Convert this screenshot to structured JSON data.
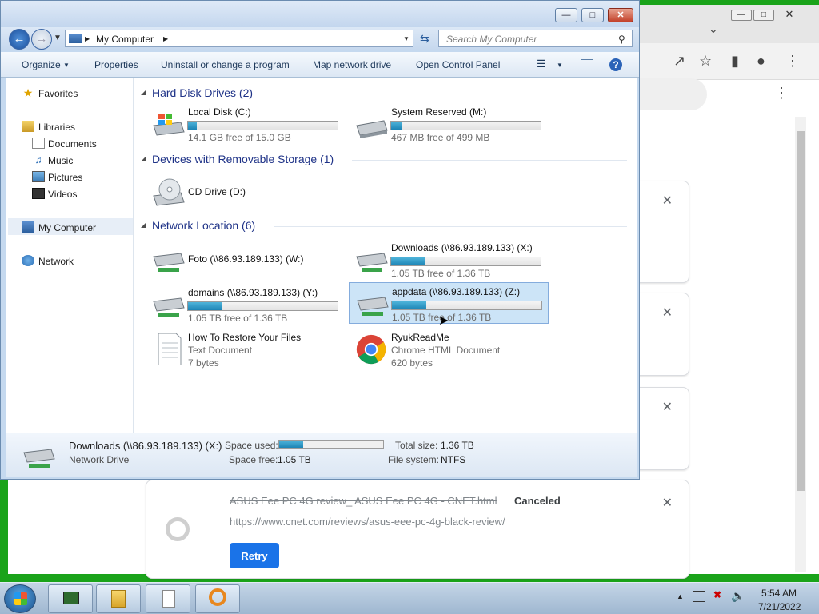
{
  "explorer": {
    "address_crumb": "My Computer",
    "search_placeholder": "Search My Computer",
    "toolbar": {
      "organize": "Organize",
      "properties": "Properties",
      "uninstall": "Uninstall or change a program",
      "map_drive": "Map network drive",
      "control_panel": "Open Control Panel"
    },
    "nav": {
      "favorites": "Favorites",
      "libraries": "Libraries",
      "documents": "Documents",
      "music": "Music",
      "pictures": "Pictures",
      "videos": "Videos",
      "my_computer": "My Computer",
      "network": "Network"
    },
    "groups": {
      "hdd": "Hard Disk Drives (2)",
      "removable": "Devices with Removable Storage (1)",
      "network": "Network Location (6)"
    },
    "drives": {
      "c": {
        "name": "Local Disk (C:)",
        "sub": "14.1 GB free of 15.0 GB",
        "used_fraction": 0.06
      },
      "m": {
        "name": "System Reserved (M:)",
        "sub": "467 MB free of 499 MB",
        "used_fraction": 0.07
      },
      "d": {
        "name": "CD Drive (D:)"
      },
      "w": {
        "name": "Foto (\\\\86.93.189.133) (W:)"
      },
      "x": {
        "name": "Downloads (\\\\86.93.189.133) (X:)",
        "sub": "1.05 TB free of 1.36 TB",
        "used_fraction": 0.23
      },
      "y": {
        "name": "domains (\\\\86.93.189.133) (Y:)",
        "sub": "1.05 TB free of 1.36 TB",
        "used_fraction": 0.23
      },
      "z": {
        "name": "appdata (\\\\86.93.189.133) (Z:)",
        "sub": "1.05 TB free of 1.36 TB",
        "used_fraction": 0.23
      }
    },
    "files": {
      "restore": {
        "name": "How To Restore Your Files",
        "type": "Text Document",
        "size": "7 bytes"
      },
      "ryuk": {
        "name": "RyukReadMe",
        "type": "Chrome HTML Document",
        "size": "620 bytes"
      }
    },
    "details": {
      "name": "Downloads (\\\\86.93.189.133) (X:)",
      "kind": "Network Drive",
      "space_used_label": "Space used:",
      "space_free_label": "Space free:",
      "space_free": "1.05 TB",
      "total_size_label": "Total size:",
      "total_size": "1.36 TB",
      "fs_label": "File system:",
      "fs": "NTFS",
      "used_fraction": 0.23
    }
  },
  "chrome": {
    "download": {
      "title": "ASUS Eee PC 4G review_ ASUS Eee PC 4G - CNET.html",
      "status": "Canceled",
      "url": "https://www.cnet.com/reviews/asus-eee-pc-4g-black-review/",
      "retry": "Retry"
    }
  },
  "taskbar": {
    "time": "5:54 AM",
    "date": "7/21/2022"
  },
  "colors": {
    "desktop": "#1aa31a",
    "accent_blue": "#1a73e8",
    "drive_bar": "#1d84b5",
    "selection": "#cce4f7"
  }
}
